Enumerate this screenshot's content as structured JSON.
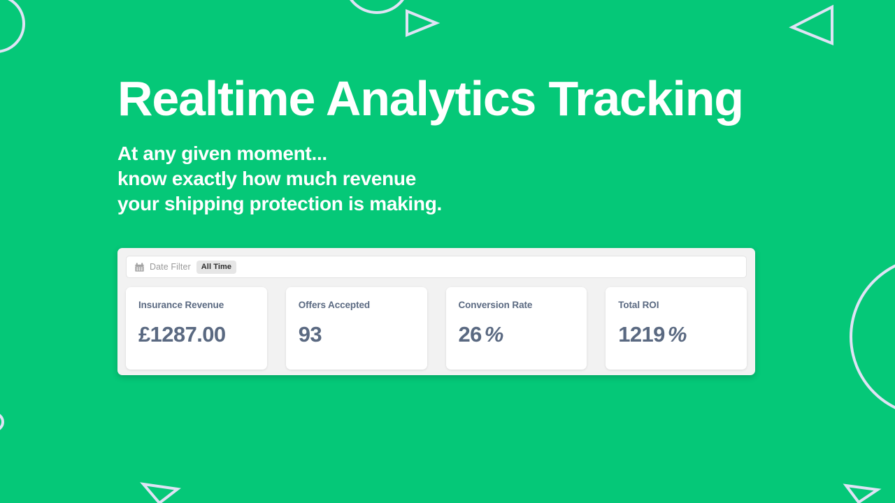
{
  "theme": {
    "background_green": "#05c878",
    "shape_outline": "#dfe3f5",
    "panel_gray": "#f2f2f2",
    "card_white": "#ffffff",
    "stat_text": "#5a6981",
    "filter_label": "#9a9a9a",
    "badge_bg": "#e6e6e6"
  },
  "hero": {
    "title": "Realtime Analytics Tracking",
    "subtitle_lines": [
      "At any given moment...",
      "know exactly how much revenue",
      "your shipping protection is making."
    ]
  },
  "dashboard": {
    "filter": {
      "icon": "calendar-icon",
      "label": "Date Filter",
      "selected_value": "All Time"
    },
    "stats": [
      {
        "label": "Insurance Revenue",
        "value": "£1287.00",
        "unit": ""
      },
      {
        "label": "Offers Accepted",
        "value": "93",
        "unit": ""
      },
      {
        "label": "Conversion Rate",
        "value": "26",
        "unit": "%"
      },
      {
        "label": "Total ROI",
        "value": "1219",
        "unit": "%"
      }
    ]
  }
}
